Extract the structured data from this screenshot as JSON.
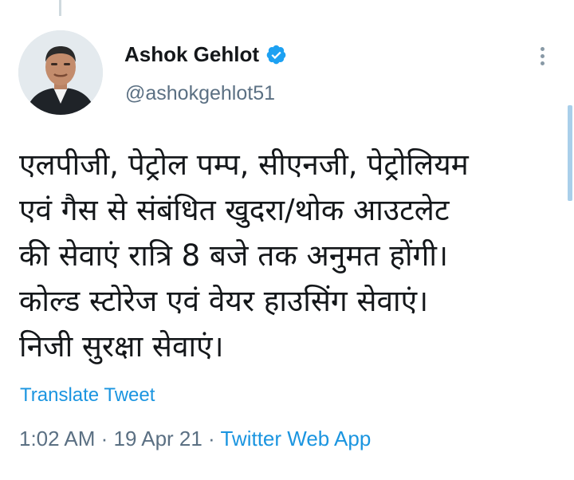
{
  "tweet": {
    "author": {
      "display_name": "Ashok Gehlot",
      "handle": "@ashokgehlot51",
      "verified": true
    },
    "text_lines": [
      "एलपीजी, पेट्रोल पम्प, सीएनजी, पेट्रोलियम",
      "एवं गैस से संबंधित खुदरा/थोक आउटलेट",
      "की सेवाएं रात्रि 8 बजे तक अनुमत होंगी।",
      "कोल्ड स्टोरेज एवं वेयर हाउसिंग सेवाएं।",
      "निजी सुरक्षा सेवाएं।"
    ],
    "translate_label": "Translate Tweet",
    "time": "1:02 AM",
    "separator": " · ",
    "date": "19 Apr 21",
    "source": "Twitter Web App"
  },
  "icons": {
    "verified": "verified-badge-icon",
    "more": "more-vertical-icon"
  },
  "colors": {
    "link": "#1b95e0",
    "secondary_text": "#5b7083",
    "primary_text": "#14171a",
    "verified_badge": "#1da1f2"
  }
}
